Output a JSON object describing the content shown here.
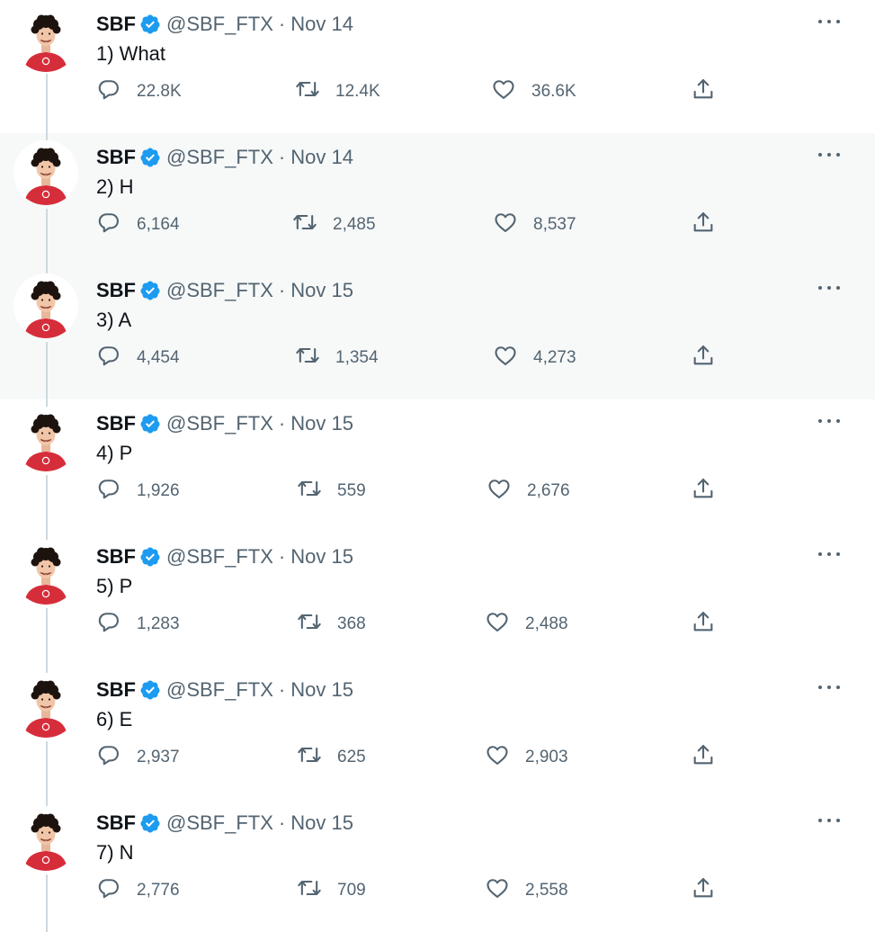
{
  "author": {
    "name": "SBF",
    "handle": "@SBF_FTX",
    "verified": true
  },
  "colors": {
    "verified": "#1d9bf0",
    "secondary": "#536471",
    "rail": "#cfd9de",
    "highlight": "#f7f9f9"
  },
  "icons": {
    "reply": "reply-icon",
    "retweet": "retweet-icon",
    "like": "like-icon",
    "share": "share-icon",
    "more": "more-icon"
  },
  "tweets": [
    {
      "date": "Nov 14",
      "text": "1) What",
      "replies": "22.8K",
      "retweets": "12.4K",
      "likes": "36.6K"
    },
    {
      "date": "Nov 14",
      "text": "2) H",
      "replies": "6,164",
      "retweets": "2,485",
      "likes": "8,537"
    },
    {
      "date": "Nov 15",
      "text": "3) A",
      "replies": "4,454",
      "retweets": "1,354",
      "likes": "4,273"
    },
    {
      "date": "Nov 15",
      "text": "4) P",
      "replies": "1,926",
      "retweets": "559",
      "likes": "2,676"
    },
    {
      "date": "Nov 15",
      "text": "5) P",
      "replies": "1,283",
      "retweets": "368",
      "likes": "2,488"
    },
    {
      "date": "Nov 15",
      "text": "6) E",
      "replies": "2,937",
      "retweets": "625",
      "likes": "2,903"
    },
    {
      "date": "Nov 15",
      "text": "7) N",
      "replies": "2,776",
      "retweets": "709",
      "likes": "2,558"
    }
  ]
}
